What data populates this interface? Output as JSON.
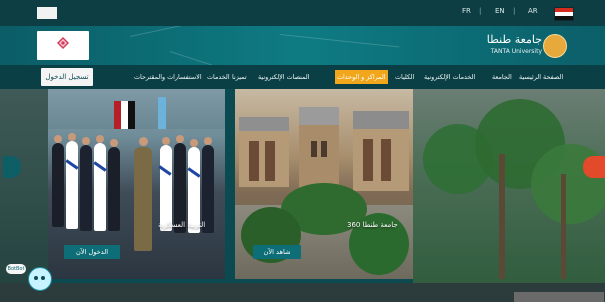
{
  "topbar": {
    "languages": [
      "FR",
      "EN",
      "AR"
    ]
  },
  "header": {
    "brand_arabic": "جامعة طنطا",
    "brand_english": "TANTA University"
  },
  "nav": {
    "login_label": "تسجيل الدخول",
    "items": [
      "الصفحة الرئيسية",
      "الجامعة",
      "الخدمات الإلكترونية",
      "الكليات",
      "المراكز و الوحدات",
      "المنصات الإلكترونية",
      "تميزنا",
      "الخدمات",
      "الاستفسارات والمقترحات"
    ],
    "active_index": 4
  },
  "cards": [
    {
      "title": "التربية العسكرية",
      "button_label": "الدخول الآن"
    },
    {
      "title": "جامعة طنطا 360",
      "button_label": "شاهد الآن"
    }
  ],
  "colors": {
    "brand_teal": "#0c6a72",
    "active_nav": "#f2a61c",
    "accent_orange": "#e24a2b"
  },
  "icons": {
    "egypt_flag": "egypt-flag-icon",
    "carousel_prev": "carousel-prev-icon",
    "carousel_next": "carousel-next-icon",
    "chatbot": "chatbot-icon",
    "university_logo": "university-logo-icon"
  },
  "chatbot": {
    "bubble_text": "BotBot"
  },
  "status": {
    "corner_text": ""
  }
}
